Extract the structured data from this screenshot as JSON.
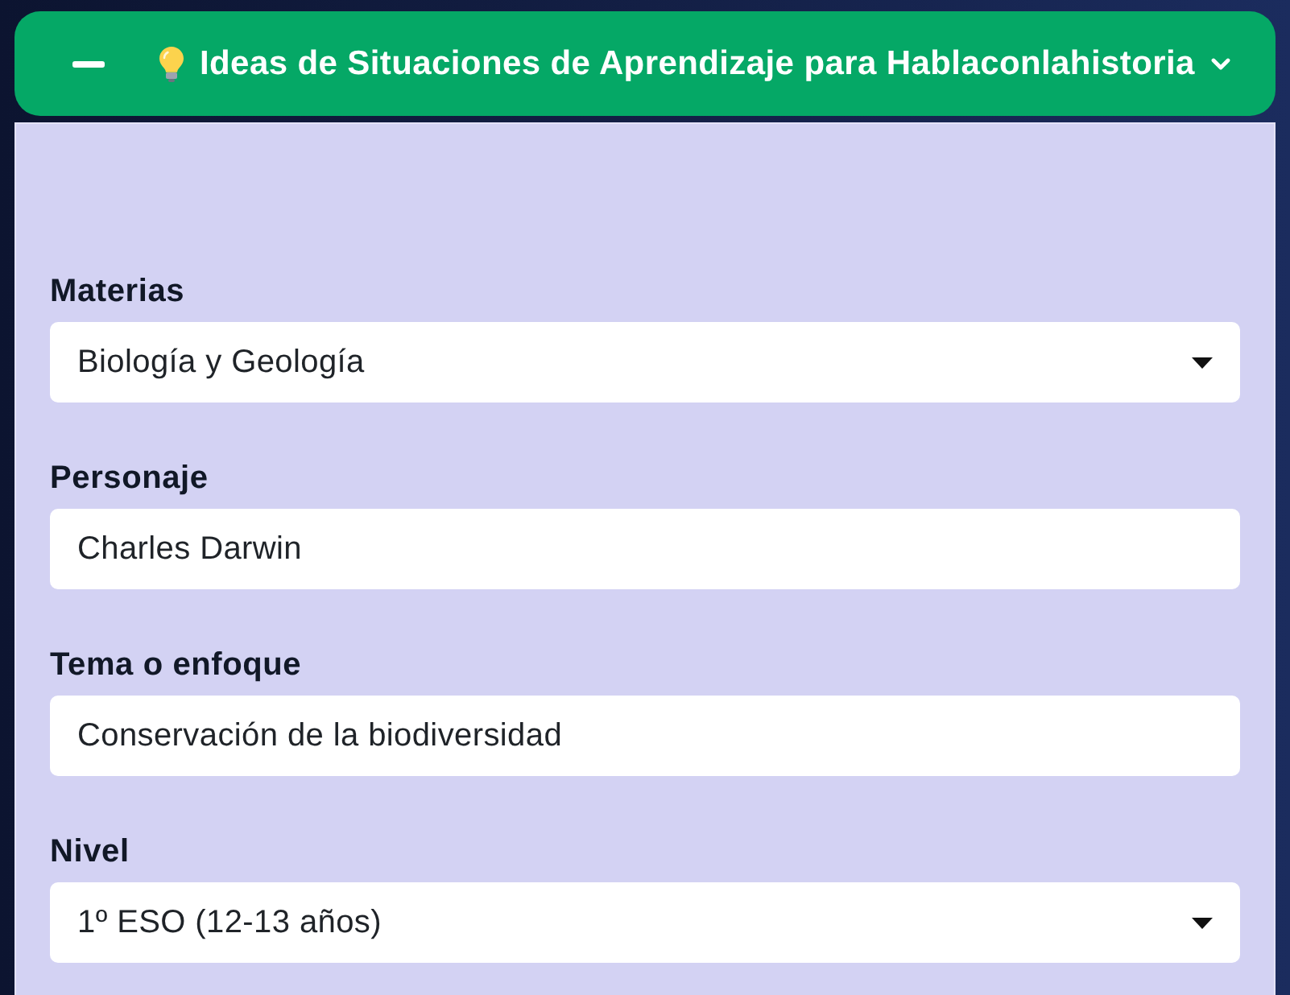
{
  "accordion": {
    "title": "Ideas de Situaciones de Aprendizaje para Hablaconlahistoria",
    "expanded": true
  },
  "form": {
    "fields": [
      {
        "kind": "select",
        "label": "Materias",
        "value": "Biología y Geología"
      },
      {
        "kind": "text",
        "label": "Personaje",
        "value": "Charles Darwin"
      },
      {
        "kind": "text",
        "label": "Tema o enfoque",
        "value": "Conservación de la biodiversidad"
      },
      {
        "kind": "select",
        "label": "Nivel",
        "value": "1º ESO (12-13 años)"
      }
    ]
  }
}
